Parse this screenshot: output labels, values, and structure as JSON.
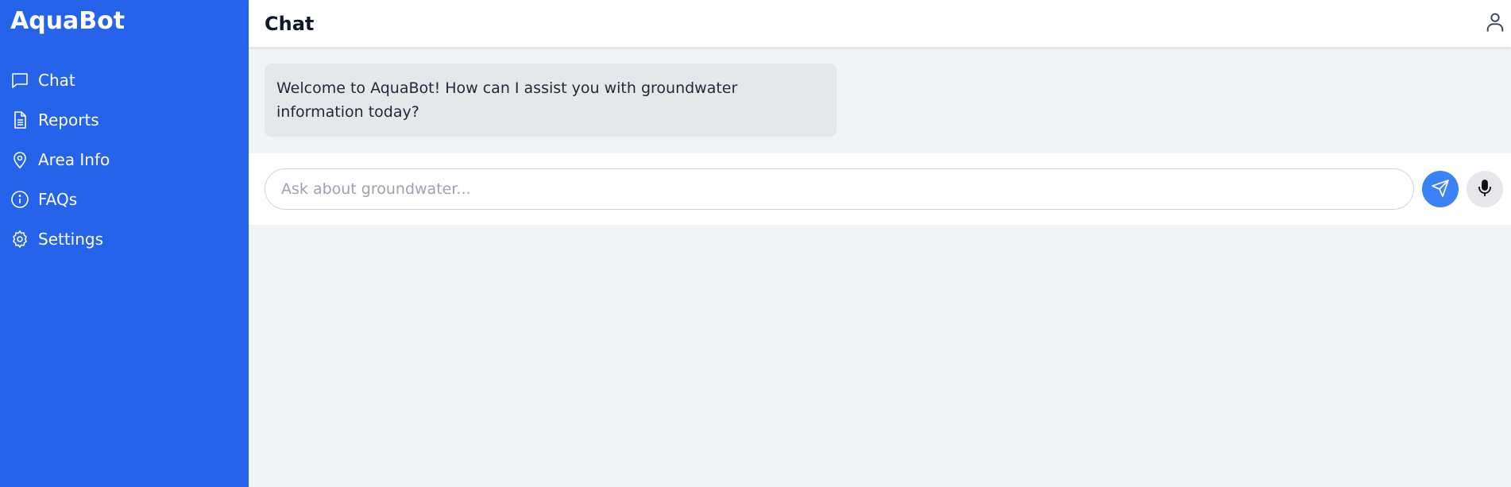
{
  "app": {
    "brand": "AquaBot"
  },
  "sidebar": {
    "items": [
      {
        "label": "Chat",
        "icon": "chat-bubble-icon"
      },
      {
        "label": "Reports",
        "icon": "document-icon"
      },
      {
        "label": "Area Info",
        "icon": "map-pin-icon"
      },
      {
        "label": "FAQs",
        "icon": "info-icon"
      },
      {
        "label": "Settings",
        "icon": "gear-icon"
      }
    ]
  },
  "header": {
    "title": "Chat",
    "user_icon": "user-icon"
  },
  "messages": [
    {
      "sender": "bot",
      "text": "Welcome to AquaBot! How can I assist you with groundwater information today?"
    }
  ],
  "composer": {
    "placeholder": "Ask about groundwater...",
    "value": "",
    "send_icon": "send-icon",
    "mic_icon": "microphone-icon"
  },
  "colors": {
    "sidebar": "#2563eb",
    "accent": "#3b82f6",
    "bubble": "#e5e7eb",
    "background": "#f3f4f6"
  }
}
